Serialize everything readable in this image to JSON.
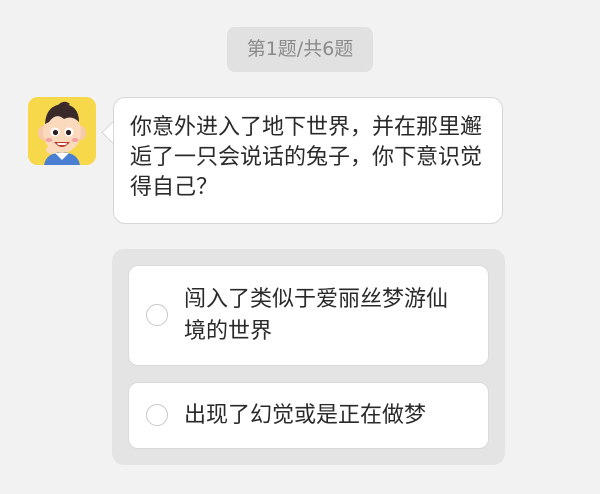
{
  "header": {
    "progress": "第1题/共6题"
  },
  "question": {
    "avatar_icon": "cartoon-boy-avatar",
    "text": "你意外进入了地下世界，并在那里邂逅了一只会说话的兔子，你下意识觉得自己？"
  },
  "options": [
    {
      "label": "闯入了类似于爱丽丝梦游仙境的世界",
      "selected": false
    },
    {
      "label": "出现了幻觉或是正在做梦",
      "selected": false
    }
  ],
  "colors": {
    "background": "#f2f2f2",
    "avatar_bg": "#f7d84a",
    "panel_bg": "#e4e4e4"
  }
}
